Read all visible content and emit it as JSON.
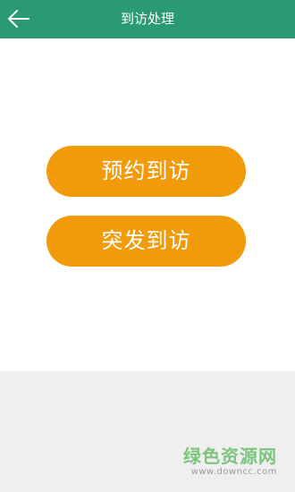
{
  "header": {
    "title": "到访处理",
    "back_icon": "arrow-left-icon",
    "background_color": "#2a9a72"
  },
  "actions": {
    "scheduled_visit_label": "预约到访",
    "sudden_visit_label": "突发到访",
    "button_color": "#f19a0a"
  },
  "watermark": {
    "title": "绿色资源网",
    "url": "www.downcc.com"
  }
}
